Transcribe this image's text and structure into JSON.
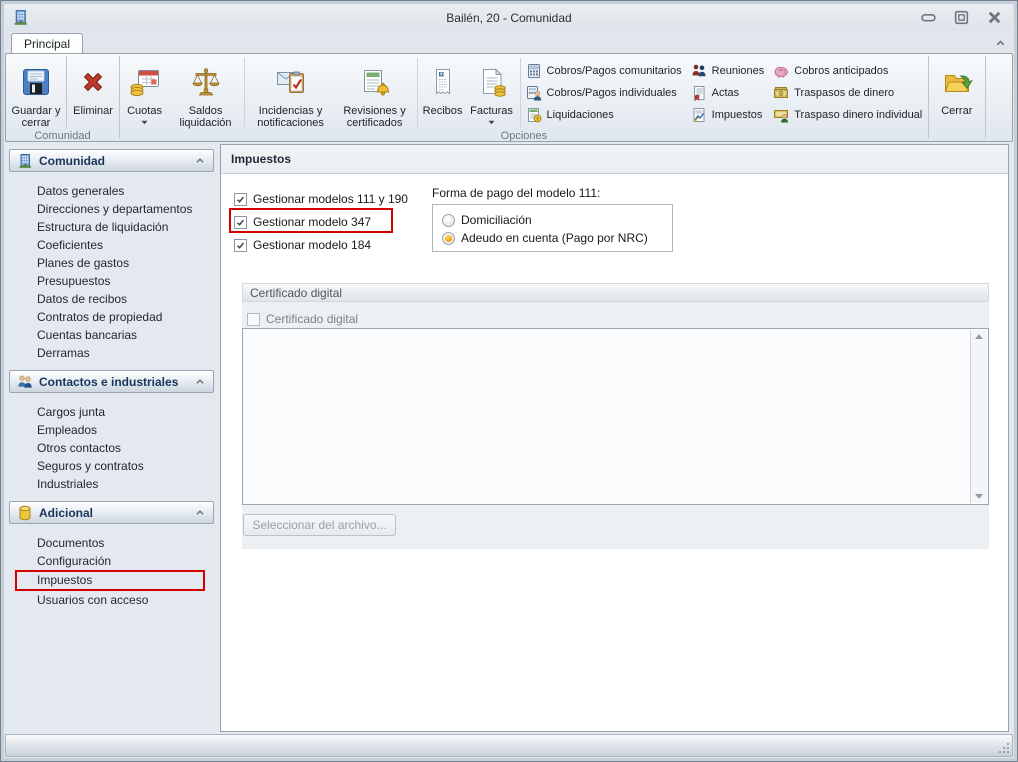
{
  "window": {
    "title": "Bailén, 20 - Comunidad"
  },
  "colors": {
    "annotation_red": "#d40000",
    "radio_selected_orange": "#f0a30a",
    "section_header_text": "#17365d"
  },
  "ribbon": {
    "tab_label": "Principal",
    "group_labels": {
      "comunidad": "Comunidad",
      "opciones": "Opciones"
    },
    "buttons": {
      "guardar": "Guardar y cerrar",
      "eliminar": "Eliminar",
      "cuotas": "Cuotas",
      "saldos": "Saldos liquidación",
      "incidencias": "Incidencias y notificaciones",
      "revisiones": "Revisiones y certificados",
      "recibos": "Recibos",
      "facturas": "Facturas",
      "cerrar": "Cerrar"
    },
    "options": {
      "col1": [
        "Cobros/Pagos comunitarios",
        "Cobros/Pagos individuales",
        "Liquidaciones"
      ],
      "col2": [
        "Reuniones",
        "Actas",
        "Impuestos"
      ],
      "col3": [
        "Cobros anticipados",
        "Traspasos de dinero",
        "Traspaso dinero individual"
      ]
    }
  },
  "sidebar": {
    "sections": [
      {
        "title": "Comunidad",
        "icon": "building-icon",
        "items": [
          "Datos generales",
          "Direcciones y departamentos",
          "Estructura de liquidación",
          "Coeficientes",
          "Planes de gastos",
          "Presupuestos",
          "Datos de recibos",
          "Contratos de propiedad",
          "Cuentas bancarias",
          "Derramas"
        ]
      },
      {
        "title": "Contactos e industriales",
        "icon": "people-icon",
        "items": [
          "Cargos junta",
          "Empleados",
          "Otros contactos",
          "Seguros y contratos",
          "Industriales"
        ]
      },
      {
        "title": "Adicional",
        "icon": "database-icon",
        "items": [
          "Documentos",
          "Configuración",
          "Impuestos",
          "Usuarios con acceso"
        ],
        "highlighted_item": "Impuestos"
      }
    ]
  },
  "main": {
    "title": "Impuestos",
    "checkboxes": [
      {
        "label": "Gestionar modelos 111 y 190",
        "checked": true
      },
      {
        "label": "Gestionar modelo 347",
        "checked": true,
        "highlighted": true
      },
      {
        "label": "Gestionar modelo 184",
        "checked": true
      }
    ],
    "payment_label": "Forma de pago del modelo 111:",
    "payment_options": [
      {
        "label": "Domiciliación",
        "selected": false
      },
      {
        "label": "Adeudo en cuenta (Pago por NRC)",
        "selected": true
      }
    ],
    "certificate": {
      "group_title": "Certificado digital",
      "checkbox_label": "Certificado digital",
      "checked": false,
      "button_label": "Seleccionar del archivo..."
    }
  },
  "icons": {
    "app": "building",
    "save": "floppy-disk",
    "delete": "red-x",
    "cuotas": "calendar-coins",
    "saldos": "balance-scales",
    "incidencias": "envelope-clipboard",
    "revisiones": "notepad-bell",
    "recibos": "receipt",
    "facturas": "invoice-coins",
    "cerrar": "folder-green-arrow",
    "window_controls": [
      "minimize",
      "restore",
      "close"
    ],
    "ribbon_collapse": "chevron-up"
  }
}
